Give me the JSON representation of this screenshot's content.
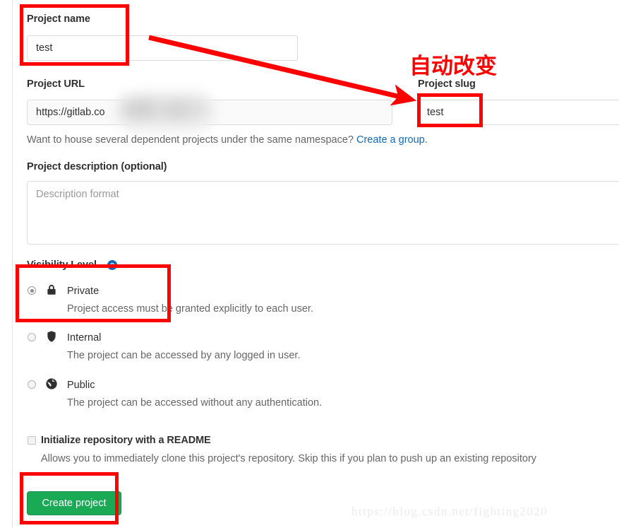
{
  "form": {
    "project_name": {
      "label": "Project name",
      "value": "test"
    },
    "project_url": {
      "label": "Project URL",
      "value": "https://gitlab.co"
    },
    "project_slug": {
      "label": "Project slug",
      "value": "test"
    },
    "namespace_hint": {
      "text": "Want to house several dependent projects under the same namespace? ",
      "link_text": "Create a group.",
      "link_color": "#1068bf"
    },
    "project_description": {
      "label": "Project description (optional)",
      "placeholder": "Description format"
    },
    "visibility": {
      "label": "Visibility Level",
      "help_icon": "question-mark-circle-icon",
      "selected": "private",
      "options": [
        {
          "id": "private",
          "icon": "lock-icon",
          "title": "Private",
          "description": "Project access must be granted explicitly to each user.",
          "checked": true
        },
        {
          "id": "internal",
          "icon": "shield-icon",
          "title": "Internal",
          "description": "The project can be accessed by any logged in user.",
          "checked": false
        },
        {
          "id": "public",
          "icon": "globe-icon",
          "title": "Public",
          "description": "The project can be accessed without any authentication.",
          "checked": false
        }
      ]
    },
    "readme": {
      "label": "Initialize repository with a README",
      "description": "Allows you to immediately clone this project's repository. Skip this if you plan to push up an existing repository",
      "checked": false
    },
    "submit": {
      "label": "Create project",
      "color": "#1aaa55"
    }
  },
  "annotations": {
    "callout_text": "自动改变",
    "callout_color": "#fe0000",
    "boxes": [
      {
        "name": "project-name-highlight"
      },
      {
        "name": "project-slug-highlight"
      },
      {
        "name": "visibility-private-highlight"
      },
      {
        "name": "create-project-highlight"
      }
    ],
    "arrow": {
      "name": "annotation-arrow",
      "from": "project-name-field",
      "to": "project-slug-field"
    }
  },
  "watermark": {
    "text": "https://blog.csdn.net/fighting2020"
  }
}
